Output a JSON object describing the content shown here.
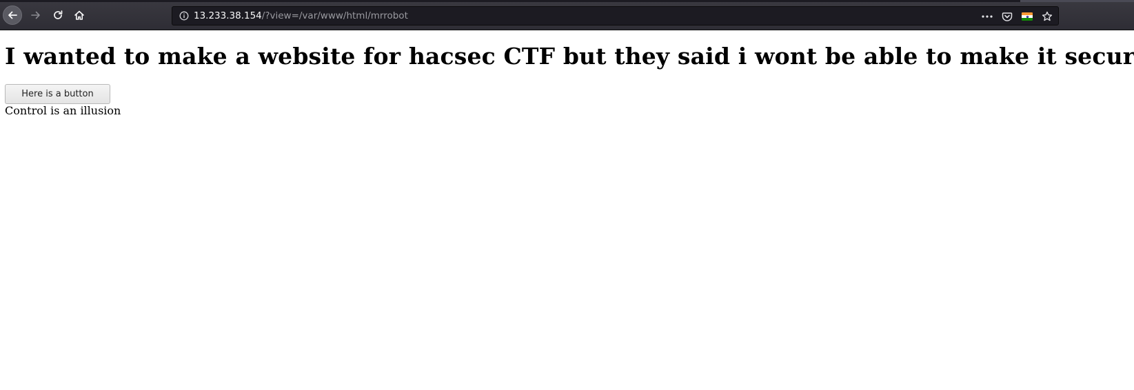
{
  "browser": {
    "url_host": "13.233.38.154",
    "url_path": "/?view=/var/www/html/mrrobot",
    "icons": {
      "back": "back-arrow-icon",
      "forward": "forward-arrow-icon",
      "reload": "reload-icon",
      "home": "home-icon",
      "site_info": "info-icon",
      "more": "more-dots-icon",
      "pocket": "pocket-icon",
      "flag": "india-flag-icon",
      "bookmark": "star-icon"
    }
  },
  "page": {
    "heading": "I wanted to make a website for hacsec CTF but they said i wont be able to make it secure",
    "button_label": "Here is a button",
    "tagline": "Control is an illusion"
  },
  "colors": {
    "toolbar_bg": "#2e2d35",
    "urlbar_bg": "#1c1b22",
    "url_host": "#f9f9fa",
    "url_path": "#9a9aa0"
  }
}
